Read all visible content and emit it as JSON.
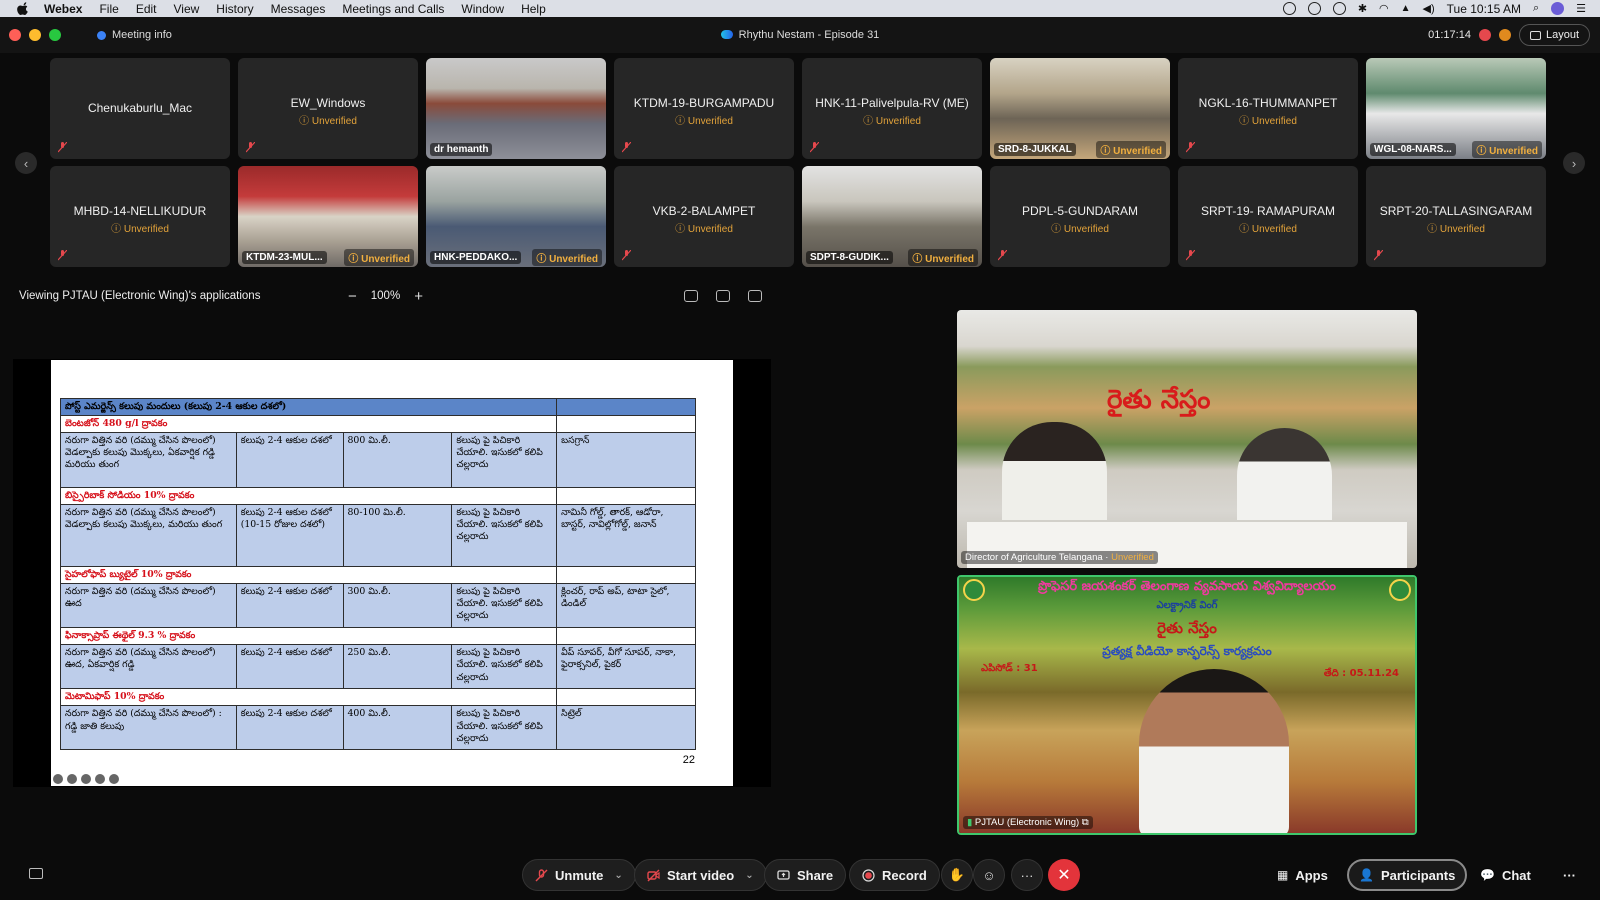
{
  "menubar": {
    "app": "Webex",
    "items": [
      "File",
      "Edit",
      "View",
      "History",
      "Messages",
      "Meetings and Calls",
      "Window",
      "Help"
    ],
    "clock": "Tue 10:15 AM"
  },
  "titlebar": {
    "meeting_info": "Meeting info",
    "title": "Rhythu Nestam - Episode 31",
    "timer": "01:17:14",
    "layout": "Layout"
  },
  "participants": {
    "row1": [
      {
        "name": "Chenukaburlu_Mac",
        "unverified": "",
        "video": false
      },
      {
        "name": "EW_Windows",
        "unverified": "Unverified",
        "video": false
      },
      {
        "name": "dr hemanth",
        "unverified": "",
        "video": true
      },
      {
        "name": "KTDM-19-BURGAMPADU",
        "unverified": "Unverified",
        "video": false
      },
      {
        "name": "HNK-11-Palivelpula-RV (ME)",
        "unverified": "Unverified",
        "video": false
      },
      {
        "name": "SRD-8-JUKKAL",
        "unverified": "Unverified",
        "video": true
      },
      {
        "name": "NGKL-16-THUMMANPET",
        "unverified": "Unverified",
        "video": false
      },
      {
        "name": "WGL-08-NARS...",
        "unverified": "Unverified",
        "video": true
      }
    ],
    "row2": [
      {
        "name": "MHBD-14-NELLIKUDUR",
        "unverified": "Unverified",
        "video": false
      },
      {
        "name": "KTDM-23-MUL...",
        "unverified": "Unverified",
        "video": true
      },
      {
        "name": "HNK-PEDDAKO...",
        "unverified": "Unverified",
        "video": true
      },
      {
        "name": "VKB-2-BALAMPET",
        "unverified": "Unverified",
        "video": false
      },
      {
        "name": "SDPT-8-GUDIK...",
        "unverified": "Unverified",
        "video": true
      },
      {
        "name": "PDPL-5-GUNDARAM",
        "unverified": "Unverified",
        "video": false
      },
      {
        "name": "SRPT-19- RAMAPURAM",
        "unverified": "Unverified",
        "video": false
      },
      {
        "name": "SRPT-20-TALLASINGARAM",
        "unverified": "Unverified",
        "video": false
      }
    ]
  },
  "share": {
    "viewing": "Viewing PJTAU (Electronic Wing)'s applications",
    "zoom_out": "−",
    "zoom": "100%",
    "zoom_in": "+"
  },
  "slide": {
    "header": "పోస్ట్ ఎమర్జెన్స్ కలుపు మందులు (కలుపు 2-4 ఆకుల దశలో)",
    "page": "22",
    "rows": [
      {
        "chemical": "బెంటజోన్ 480 g/l ద్రావకం",
        "crop": "నరుగా విత్తిన వరి (దమ్ము చేసిన పొలంలో) వెడల్పాకు కలుపు మొక్కలు, ఏకవార్షిక గడ్డి మరియు తుంగ",
        "stage": "కలుపు 2-4 ఆకుల దశలో",
        "dose": "800 మి.లీ.",
        "method": "కలుపు పై పిచికారి చేయాలి. ఇసుకలో కలిపి చల్లరాదు",
        "brands": "బసగ్రాన్"
      },
      {
        "chemical": "బిస్పైరిబాక్ సోడియం 10% ద్రావకం",
        "crop": "నరుగా విత్తిన వరి (దమ్ము చేసిన పొలంలో) వెడల్పాకు కలుపు మొక్కలు, మరియు తుంగ",
        "stage": "కలుపు 2-4 ఆకుల దశలో (10-15 రోజుల దశలో)",
        "dose": "80-100 మి.లీ.",
        "method": "కలుపు పై పిచికారి చేయాలి. ఇసుకలో కలిపి చల్లరాదు",
        "brands": "నామినీ గోల్డ్, తారక్, ఆడోరా, బాస్టర్, నావిల్లోగోల్డ్, జనాన్"
      },
      {
        "chemical": "సైహలోఫాప్ బ్యుటైల్ 10% ద్రావకం",
        "crop": "నరుగా విత్తిన వరి (దమ్ము చేసిన పొలంలో) ఊద",
        "stage": "కలుపు 2-4 ఆకుల దశలో",
        "dose": "300 మి.లీ.",
        "method": "కలుపు పై పిచికారి చేయాలి. ఇసుకలో కలిపి చల్లరాదు",
        "brands": "క్లించర్, రాప్ అప్, టాటా సైలో, డిండిల్"
      },
      {
        "chemical": "ఫినాక్సాప్రాప్ ఈథైల్ 9.3 % ద్రావకం",
        "crop": "నరుగా విత్తిన వరి (దమ్ము చేసిన పొలంలో) ఊద, ఏకవార్షిక గడ్డి",
        "stage": "కలుపు 2-4 ఆకుల దశలో",
        "dose": "250 మి.లీ.",
        "method": "కలుపు పై పిచికారి చేయాలి. ఇసుకలో కలిపి చల్లరాదు",
        "brands": "వీప్ సూపర్, వీగో సూపర్, నాకా, ఫైరాక్సనిల్, పైకర్"
      },
      {
        "chemical": "మెటామిఫాప్ 10% ద్రావకం",
        "crop": "నరుగా విత్తిన వరి (దమ్ము చేసిన పొలంలో) : గడ్డి జాతి కలుపు",
        "stage": "కలుపు 2-4 ఆకుల దశలో",
        "dose": "400 మి.లీ.",
        "method": "కలుపు పై పిచికారి చేయాలి. ఇసుకలో కలిపి చల్లరాదు",
        "brands": "సిట్రెల్"
      }
    ]
  },
  "stage": {
    "video1_label": "Director of Agriculture Telangana",
    "video1_unverified": "Unverified",
    "video1_banner": "రైతు నేస్తం",
    "video2_label": "PJTAU (Electronic Wing)",
    "video2_title": "ప్రొఫెసర్ జయశంకర్ తెలంగాణ వ్యవసాయ విశ్వవిద్యాలయం",
    "video2_sub": "ఎలక్ట్రానిక్ వింగ్",
    "video2_banner": "రైతు నేస్తం",
    "video2_program": "ప్రత్యక్ష వీడియో కాన్ఫరెన్స్ కార్యక్రమం",
    "video2_episode": "ఎపిసోడ్ : 31",
    "video2_date": "తేది : 05.11.24"
  },
  "toolbar": {
    "unmute": "Unmute",
    "start_video": "Start video",
    "share": "Share",
    "record": "Record",
    "more": "···",
    "leave": "✕",
    "apps": "Apps",
    "participants": "Participants",
    "chat": "Chat",
    "overflow": "···"
  },
  "colors": {
    "accent_green": "#3fc76c",
    "unverified": "#e3a33a",
    "leave_red": "#e3343b",
    "slide_header_blue": "#5b85c8",
    "slide_body_blue": "#bdcdea",
    "slide_category_red": "#d6101a"
  }
}
